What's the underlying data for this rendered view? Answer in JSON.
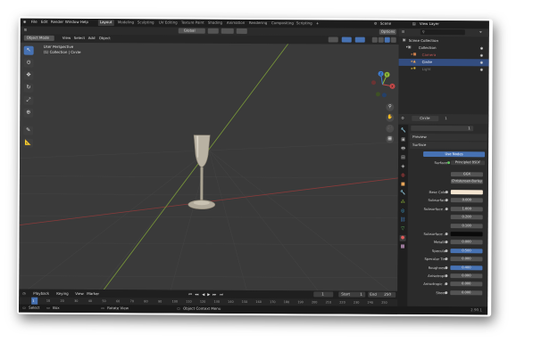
{
  "menubar": {
    "items": [
      "File",
      "Edit",
      "Render",
      "Window",
      "Help"
    ],
    "workspaces": [
      "Layout",
      "Modeling",
      "Sculpting",
      "UV Editing",
      "Texture Paint",
      "Shading",
      "Animation",
      "Rendering",
      "Compositing",
      "Scripting"
    ],
    "add_tab": "+",
    "scene_label": "Scene",
    "view_layer_label": "View Layer"
  },
  "viewport_header": {
    "mode": "Object Mode",
    "menus": [
      "View",
      "Select",
      "Add",
      "Object"
    ],
    "orientation": "Global",
    "options": "Options"
  },
  "viewport": {
    "overlay_line1": "User Perspective",
    "overlay_line2": "(1) Collection | Circle",
    "gizmo": {
      "x": "X",
      "y": "Y",
      "z": "Z"
    }
  },
  "outliner": {
    "title": "Scene Collection",
    "items": [
      {
        "label": "Collection",
        "icon": "collection-icon"
      },
      {
        "label": "Camera",
        "icon": "camera-icon"
      },
      {
        "label": "Circle",
        "icon": "mesh-icon"
      },
      {
        "label": "Light",
        "icon": "light-icon"
      }
    ]
  },
  "properties": {
    "object_name": "Circle",
    "user_count": "1",
    "material_slot": "1",
    "sections": {
      "preview": "Preview",
      "surface": "Surface"
    },
    "use_nodes": "Use Nodes",
    "surface_label": "Surface",
    "surface_value": "Principled BSDF",
    "distribution": "GGX",
    "subsurface_method": "Christensen-Burley",
    "rows": [
      {
        "label": "Base Color",
        "value": "",
        "kind": "color",
        "color": "#f5e6d2"
      },
      {
        "label": "Subsurface",
        "value": "0.000",
        "kind": "field"
      },
      {
        "label": "Subsurface ...",
        "value": "1.000",
        "kind": "field"
      },
      {
        "label": "",
        "value": "0.200",
        "kind": "field"
      },
      {
        "label": "",
        "value": "0.100",
        "kind": "field"
      },
      {
        "label": "Subsurface ...",
        "value": "",
        "kind": "color",
        "color": "#0a0a0a"
      },
      {
        "label": "Metallic",
        "value": "0.000",
        "kind": "field"
      },
      {
        "label": "Specular",
        "value": "0.500",
        "kind": "blue"
      },
      {
        "label": "Specular Tint",
        "value": "0.000",
        "kind": "field"
      },
      {
        "label": "Roughness",
        "value": "0.400",
        "kind": "blue"
      },
      {
        "label": "Anisotropic",
        "value": "0.000",
        "kind": "field"
      },
      {
        "label": "Anisotropic ...",
        "value": "0.000",
        "kind": "field"
      },
      {
        "label": "Sheen",
        "value": "0.000",
        "kind": "field"
      }
    ]
  },
  "timeline": {
    "menus": [
      "Playback",
      "Keying",
      "View",
      "Marker"
    ],
    "current_frame": "1",
    "start_label": "Start",
    "start_value": "1",
    "end_label": "End",
    "end_value": "250",
    "ticks": [
      "1",
      "10",
      "20",
      "30",
      "40",
      "50",
      "60",
      "70",
      "80",
      "90",
      "100",
      "110",
      "120",
      "130",
      "140",
      "150",
      "160",
      "170",
      "180",
      "190",
      "200",
      "210",
      "220",
      "230",
      "240",
      "250"
    ]
  },
  "statusbar": {
    "select": "Select",
    "box": "Box",
    "rotate": "Rotate View",
    "context": "Object Context Menu",
    "version": "2.90.1"
  },
  "colors": {
    "accent": "#4772b3",
    "selected_tab": "#3d3d3d",
    "x_axis": "#c84a4a",
    "y_axis": "#8fb838",
    "z_axis": "#3f7fd6"
  }
}
